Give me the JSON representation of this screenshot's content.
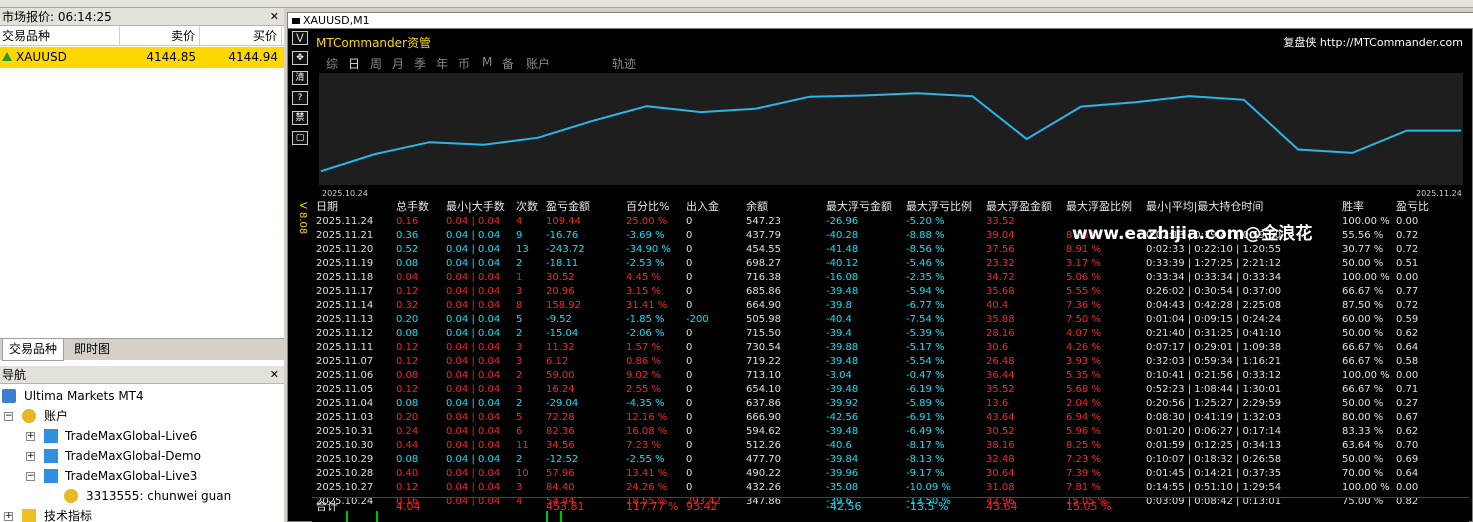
{
  "market_watch": {
    "title": "市场报价: 06:14:25",
    "cols": [
      "交易品种",
      "卖价",
      "买价"
    ],
    "row": {
      "symbol": "XAUUSD",
      "bid": "4144.85",
      "ask": "4144.94"
    }
  },
  "tabs": [
    "交易品种",
    "即时图"
  ],
  "navigator": {
    "title": "导航",
    "items": [
      "Ultima Markets MT4",
      "账户",
      "TradeMaxGlobal-Live6",
      "TradeMaxGlobal-Demo",
      "TradeMaxGlobal-Live3",
      "3313555: chunwei guan",
      "技术指标"
    ]
  },
  "chart": {
    "title": "XAUUSD,M1",
    "version": "V 8.08",
    "brand": "MTCommander资管",
    "review": "复盘侠 http://MTCommander.com",
    "menu": [
      "综",
      "日",
      "周",
      "月",
      "季",
      "年",
      "币",
      "M",
      "备",
      "账户",
      "轨迹"
    ],
    "selected_menu": "日",
    "date_start": "2025.10.24",
    "date_end": "2025.11.24",
    "line_color": "#29b6e8"
  },
  "chart_data": {
    "type": "line",
    "x": [
      "2025.10.24",
      "2025.10.27",
      "2025.10.28",
      "2025.10.29",
      "2025.10.30",
      "2025.10.31",
      "2025.11.03",
      "2025.11.04",
      "2025.11.05",
      "2025.11.06",
      "2025.11.07",
      "2025.11.10",
      "2025.11.11",
      "2025.11.12",
      "2025.11.13",
      "2025.11.14",
      "2025.11.17",
      "2025.11.18",
      "2025.11.19",
      "2025.11.20",
      "2025.11.21",
      "2025.11.24"
    ],
    "values": [
      347.86,
      432.26,
      490.22,
      477.7,
      512.26,
      594.62,
      666.9,
      637.86,
      654.1,
      713.1,
      719.22,
      730.54,
      715.5,
      505.98,
      664.9,
      685.86,
      716.38,
      698.27,
      454.55,
      437.79,
      547.23,
      547.23
    ]
  },
  "table": {
    "headers": [
      "日期",
      "总手数",
      "最小|大手数",
      "次数",
      "盈亏金额",
      "百分比%",
      "出入金",
      "余额",
      "最大浮亏金额",
      "最大浮亏比例",
      "最大浮盈金额",
      "最大浮盈比例",
      "最小|平均|最大持仓时间",
      "胜率",
      "盈亏比"
    ],
    "rows": [
      [
        "2025.11.24",
        "0.16",
        "0.04 | 0.04",
        "4",
        "109.44",
        "25.00 %",
        "0",
        "547.23",
        "-26.96",
        "-5.20 %",
        "33.52",
        "",
        "",
        "100.00 %",
        "0.00",
        "r"
      ],
      [
        "2025.11.21",
        "0.36",
        "0.04 | 0.04",
        "9",
        "-16.76",
        "-3.69 %",
        "0",
        "437.79",
        "-40.28",
        "-8.88 %",
        "39.04",
        "8.10 %",
        "0:02:13 | 0:19:41 | 0:59:50",
        "55.56 %",
        "0.72",
        "c"
      ],
      [
        "2025.11.20",
        "0.52",
        "0.04 | 0.04",
        "13",
        "-243.72",
        "-34.90 %",
        "0",
        "454.55",
        "-41.48",
        "-8.56 %",
        "37.56",
        "8.91 %",
        "0:02:33 | 0:22:10 | 1:20:55",
        "30.77 %",
        "0.72",
        "c"
      ],
      [
        "2025.11.19",
        "0.08",
        "0.04 | 0.04",
        "2",
        "-18.11",
        "-2.53 %",
        "0",
        "698.27",
        "-40.12",
        "-5.46 %",
        "23.32",
        "3.17 %",
        "0:33:39 | 1:27:25 | 2:21:12",
        "50.00 %",
        "0.51",
        "c"
      ],
      [
        "2025.11.18",
        "0.04",
        "0.04 | 0.04",
        "1",
        "30.52",
        "4.45 %",
        "0",
        "716.38",
        "-16.08",
        "-2.35 %",
        "34.72",
        "5.06 %",
        "0:33:34 | 0:33:34 | 0:33:34",
        "100.00 %",
        "0.00",
        "r"
      ],
      [
        "2025.11.17",
        "0.12",
        "0.04 | 0.04",
        "3",
        "20.96",
        "3.15 %",
        "0",
        "685.86",
        "-39.48",
        "-5.94 %",
        "35.68",
        "5.55 %",
        "0:26:02 | 0:30:54 | 0:37:00",
        "66.67 %",
        "0.77",
        "r"
      ],
      [
        "2025.11.14",
        "0.32",
        "0.04 | 0.04",
        "8",
        "158.92",
        "31.41 %",
        "0",
        "664.90",
        "-39.8",
        "-6.77 %",
        "40.4",
        "7.36 %",
        "0:04:43 | 0:42:28 | 2:25:08",
        "87.50 %",
        "0.72",
        "r"
      ],
      [
        "2025.11.13",
        "0.20",
        "0.04 | 0.04",
        "5",
        "-9.52",
        "-1.85 %",
        "-200",
        "505.98",
        "-40.4",
        "-7.54 %",
        "35.88",
        "7.50 %",
        "0:01:04 | 0:09:15 | 0:24:24",
        "60.00 %",
        "0.59",
        "c"
      ],
      [
        "2025.11.12",
        "0.08",
        "0.04 | 0.04",
        "2",
        "-15.04",
        "-2.06 %",
        "0",
        "715.50",
        "-39.4",
        "-5.39 %",
        "28.16",
        "4.07 %",
        "0:21:40 | 0:31:25 | 0:41:10",
        "50.00 %",
        "0.62",
        "c"
      ],
      [
        "2025.11.11",
        "0.12",
        "0.04 | 0.04",
        "3",
        "11.32",
        "1.57 %",
        "0",
        "730.54",
        "-39.88",
        "-5.17 %",
        "30.6",
        "4.26 %",
        "0:07:17 | 0:29:01 | 1:09:38",
        "66.67 %",
        "0.64",
        "r"
      ],
      [
        "2025.11.07",
        "0.12",
        "0.04 | 0.04",
        "3",
        "6.12",
        "0.86 %",
        "0",
        "719.22",
        "-39.48",
        "-5.54 %",
        "26.48",
        "3.93 %",
        "0:32:03 | 0:59:34 | 1:16:21",
        "66.67 %",
        "0.58",
        "r"
      ],
      [
        "2025.11.06",
        "0.08",
        "0.04 | 0.04",
        "2",
        "59.00",
        "9.02 %",
        "0",
        "713.10",
        "-3.04",
        "-0.47 %",
        "36.44",
        "5.35 %",
        "0:10:41 | 0:21:56 | 0:33:12",
        "100.00 %",
        "0.00",
        "r"
      ],
      [
        "2025.11.05",
        "0.12",
        "0.04 | 0.04",
        "3",
        "16.24",
        "2.55 %",
        "0",
        "654.10",
        "-39.48",
        "-6.19 %",
        "35.52",
        "5.68 %",
        "0:52:23 | 1:08:44 | 1:30:01",
        "66.67 %",
        "0.71",
        "r"
      ],
      [
        "2025.11.04",
        "0.08",
        "0.04 | 0.04",
        "2",
        "-29.04",
        "-4.35 %",
        "0",
        "637.86",
        "-39.92",
        "-5.89 %",
        "13.6",
        "2.04 %",
        "0:20:56 | 1:25:27 | 2:29:59",
        "50.00 %",
        "0.27",
        "c"
      ],
      [
        "2025.11.03",
        "0.20",
        "0.04 | 0.04",
        "5",
        "72.28",
        "12.16 %",
        "0",
        "666.90",
        "-42.56",
        "-6.91 %",
        "43.64",
        "6.94 %",
        "0:08:30 | 0:41:19 | 1:32:03",
        "80.00 %",
        "0.67",
        "r"
      ],
      [
        "2025.10.31",
        "0.24",
        "0.04 | 0.04",
        "6",
        "82.36",
        "16.08 %",
        "0",
        "594.62",
        "-39.48",
        "-6.49 %",
        "30.52",
        "5.96 %",
        "0:01:20 | 0:06:27 | 0:17:14",
        "83.33 %",
        "0.62",
        "r"
      ],
      [
        "2025.10.30",
        "0.44",
        "0.04 | 0.04",
        "11",
        "34.56",
        "7.23 %",
        "0",
        "512.26",
        "-40.6",
        "-8.17 %",
        "38.16",
        "8.25 %",
        "0:01:59 | 0:12:25 | 0:34:13",
        "63.64 %",
        "0.70",
        "r"
      ],
      [
        "2025.10.29",
        "0.08",
        "0.04 | 0.04",
        "2",
        "-12.52",
        "-2.55 %",
        "0",
        "477.70",
        "-39.84",
        "-8.13 %",
        "32.48",
        "7.23 %",
        "0:10:07 | 0:18:32 | 0:26:58",
        "50.00 %",
        "0.69",
        "c"
      ],
      [
        "2025.10.28",
        "0.40",
        "0.04 | 0.04",
        "10",
        "57.96",
        "13.41 %",
        "0",
        "490.22",
        "-39.96",
        "-9.17 %",
        "30.64",
        "7.39 %",
        "0:01:45 | 0:14:21 | 0:37:35",
        "70.00 %",
        "0.64",
        "r"
      ],
      [
        "2025.10.27",
        "0.12",
        "0.04 | 0.04",
        "3",
        "84.40",
        "24.26 %",
        "0",
        "432.26",
        "-35.08",
        "-10.09 %",
        "31.08",
        "7.81 %",
        "0:14:55 | 0:51:10 | 1:29:54",
        "100.00 %",
        "0.00",
        "r"
      ],
      [
        "2025.10.24",
        "0.16",
        "0.04 | 0.04",
        "4",
        "54.44",
        "18.55 %",
        "293.42",
        "347.86",
        "-39.6",
        "-13.50 %",
        "42.96",
        "15.05 %",
        "0:03:09 | 0:08:42 | 0:13:01",
        "75.00 %",
        "0.82",
        "r"
      ]
    ],
    "total": {
      "label": "合计",
      "lots": "4.04",
      "pnl": "453.81",
      "pct": "117.77 %",
      "flow": "93.42",
      "max_loss": "-42.56",
      "max_loss_pct": "-13.5 %",
      "max_gain": "43.64",
      "max_gain_pct": "15.05 %"
    }
  },
  "watermark": "www.eazhijia.com@金浪花"
}
